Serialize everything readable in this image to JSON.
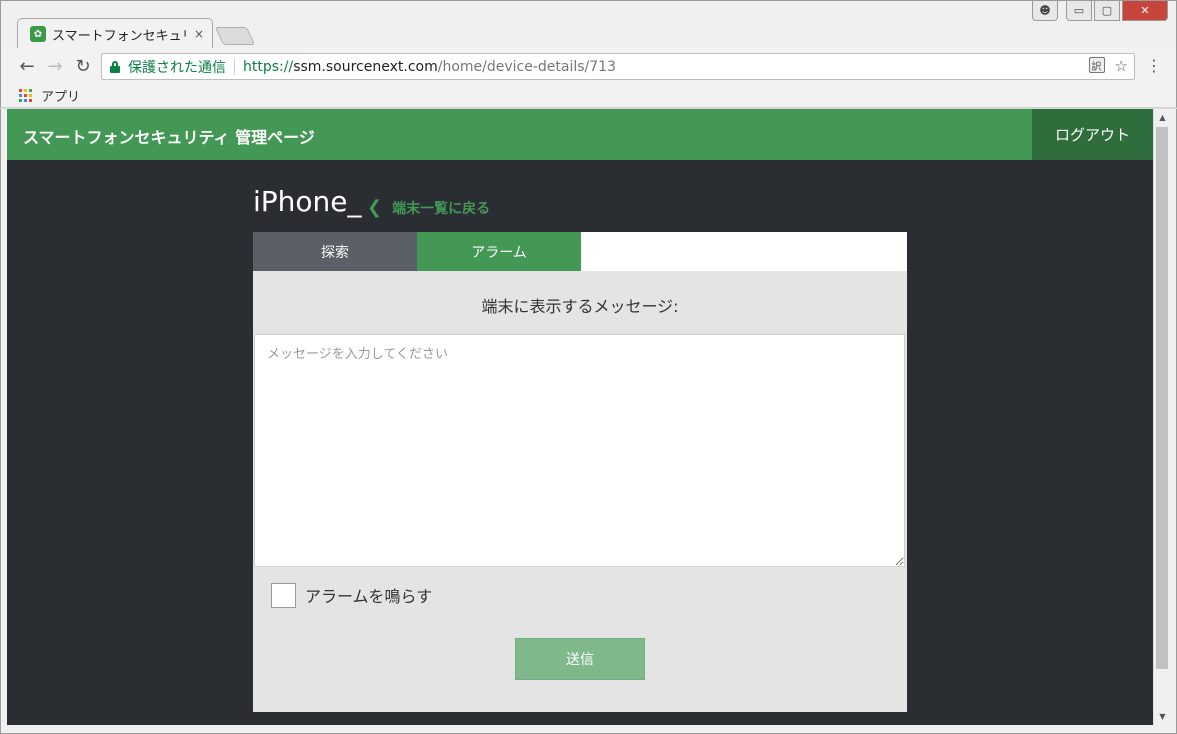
{
  "browser": {
    "tab_title": "スマートフォンセキュリテ",
    "tab_close": "×",
    "secure_label": "保護された通信",
    "url_scheme": "https://",
    "url_host": "ssm.sourcenext.com",
    "url_path": "/home/device-details/713",
    "bookmark_apps": "アプリ",
    "window_buttons": {
      "minimize": "▭",
      "maximize": "▢",
      "close": "✕"
    }
  },
  "header": {
    "title": "スマートフォンセキュリティ 管理ページ",
    "logout": "ログアウト"
  },
  "device": {
    "name": "iPhone_",
    "back_link": "端末一覧に戻る"
  },
  "tabs": {
    "search": "探索",
    "alarm": "アラーム"
  },
  "form": {
    "message_label": "端末に表示するメッセージ:",
    "message_placeholder": "メッセージを入力してください",
    "message_value": "",
    "alarm_checkbox_label": "アラームを鳴らす",
    "alarm_checked": false,
    "send_button": "送信"
  },
  "colors": {
    "brand_green": "#439856",
    "dark_bg": "#2a2d31",
    "search_tab": "#5a5f68",
    "send_button": "#7fb98b"
  }
}
